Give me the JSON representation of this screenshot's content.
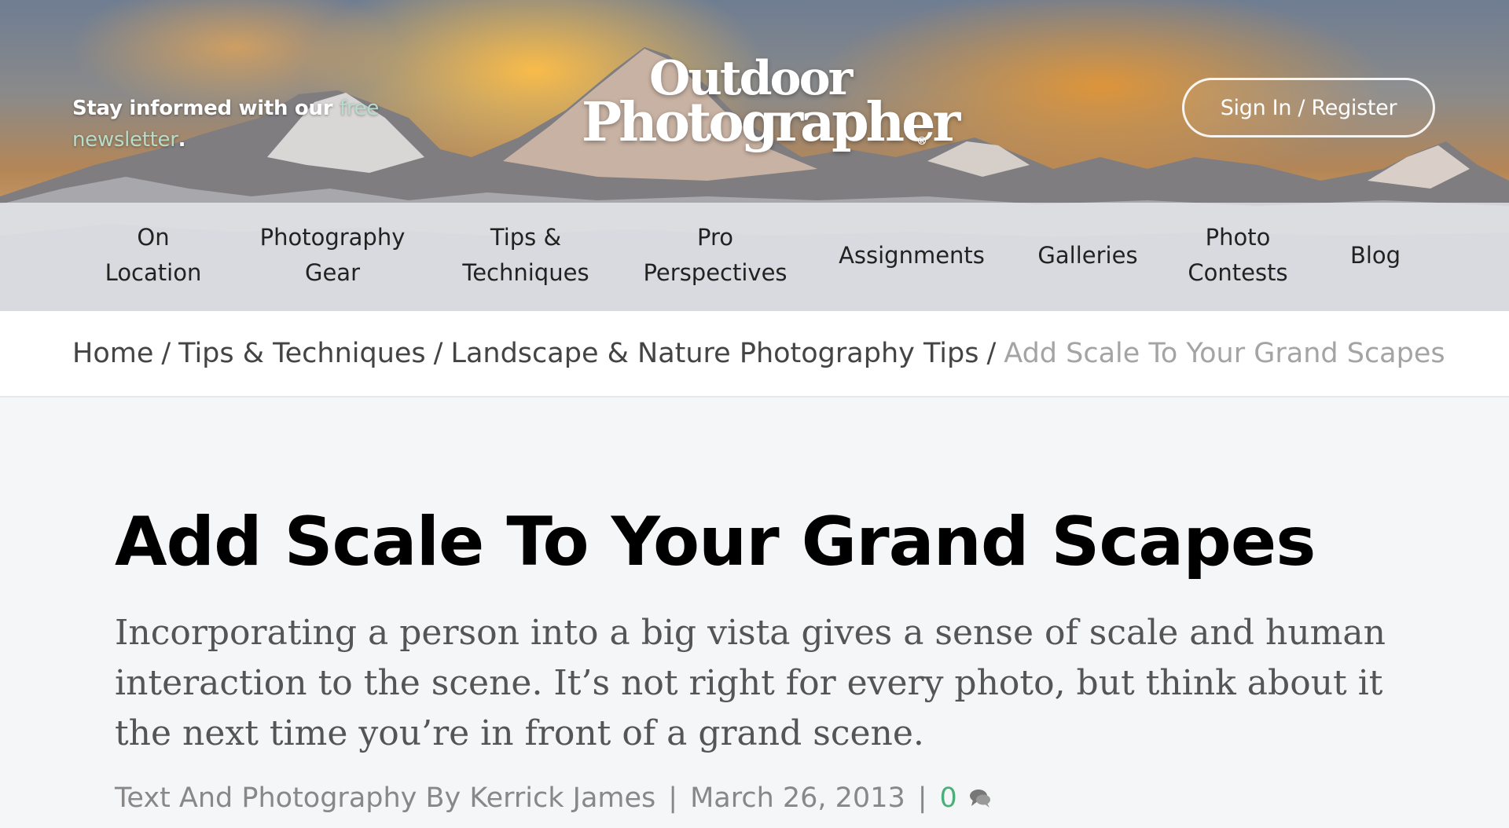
{
  "header": {
    "newsletter_prefix": "Stay informed with our ",
    "newsletter_link": "free newsletter",
    "newsletter_suffix": ".",
    "logo_line1": "Outdoor",
    "logo_line2": "Photographer",
    "logo_reg": "®",
    "signin_label": "Sign In / Register"
  },
  "nav": {
    "items": [
      {
        "label": "On\nLocation"
      },
      {
        "label": "Photography\nGear"
      },
      {
        "label": "Tips &\nTechniques"
      },
      {
        "label": "Pro\nPerspectives"
      },
      {
        "label": "Assignments"
      },
      {
        "label": "Galleries"
      },
      {
        "label": "Photo\nContests"
      },
      {
        "label": "Blog"
      }
    ]
  },
  "breadcrumb": {
    "home": "Home",
    "level1": "Tips & Techniques",
    "level2": "Landscape & Nature Photography Tips",
    "current": "Add Scale To Your Grand Scapes",
    "separator": "/"
  },
  "article": {
    "title": "Add Scale To Your Grand Scapes",
    "dek": "Incorporating a person into a big vista gives a sense of scale and human interaction to the scene. It’s not right for every photo, but think about it the next time you’re in front of a grand scene.",
    "byline": "Text And Photography By Kerrick James",
    "date": "March 26, 2013",
    "comment_count": "0",
    "comment_icon": "comment-bubble-icon"
  },
  "colors": {
    "link_green": "#b8dccb",
    "comment_count": "#4caf7a",
    "breadcrumb_current": "#a4a4a4"
  }
}
